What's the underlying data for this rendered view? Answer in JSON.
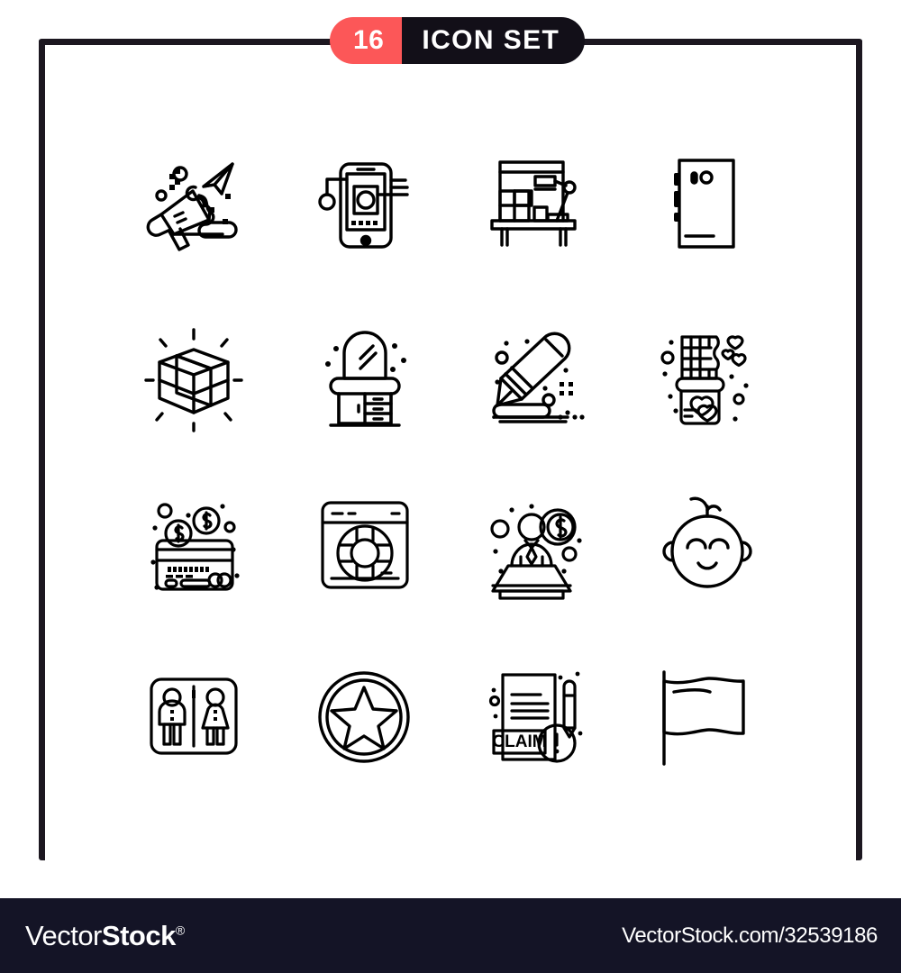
{
  "header": {
    "count": "16",
    "label": "ICON SET",
    "count_bg": "#fc5758",
    "label_bg": "#120f18",
    "text_color": "#ffffff"
  },
  "frame": {
    "border_color": "#1c1720"
  },
  "icons": [
    {
      "id": 1,
      "name": "megaphone-paper-plane-icon",
      "label": "Megaphone with paper plane"
    },
    {
      "id": 2,
      "name": "smartphone-photo-icon",
      "label": "Smartphone photo screen"
    },
    {
      "id": 3,
      "name": "desk-workspace-icon",
      "label": "Desk with shelves and lamp"
    },
    {
      "id": 4,
      "name": "phone-back-camera-icon",
      "label": "Phone back with camera"
    },
    {
      "id": 5,
      "name": "cube-shine-icon",
      "label": "3D cube with rays"
    },
    {
      "id": 6,
      "name": "dressing-table-icon",
      "label": "Dressing table with mirror"
    },
    {
      "id": 7,
      "name": "pencil-drawing-icon",
      "label": "Pencil drawing a line"
    },
    {
      "id": 8,
      "name": "chocolate-bar-hearts-icon",
      "label": "Chocolate bar with hearts"
    },
    {
      "id": 9,
      "name": "credit-card-coins-icon",
      "label": "Credit card with dollar coins"
    },
    {
      "id": 10,
      "name": "browser-lifebuoy-icon",
      "label": "Browser window with lifebuoy"
    },
    {
      "id": 11,
      "name": "businessman-podium-icon",
      "label": "Businessman at desk with dollar coin"
    },
    {
      "id": 12,
      "name": "baby-face-icon",
      "label": "Smiling baby face"
    },
    {
      "id": 13,
      "name": "restroom-sign-icon",
      "label": "Restroom sign male and female"
    },
    {
      "id": 14,
      "name": "star-badge-icon",
      "label": "Star badge medal"
    },
    {
      "id": 15,
      "name": "claim-document-icon",
      "label": "Claim document with pencil"
    },
    {
      "id": 16,
      "name": "flag-icon",
      "label": "Waving flag"
    }
  ],
  "icon_texts": {
    "claim": "CLAIM",
    "card_number": "0404 0404"
  },
  "footer": {
    "logo_vector": "Vector",
    "logo_stock": "Stock",
    "logo_reg": "®",
    "url": "VectorStock.com/32539186",
    "bg": "#141426"
  }
}
